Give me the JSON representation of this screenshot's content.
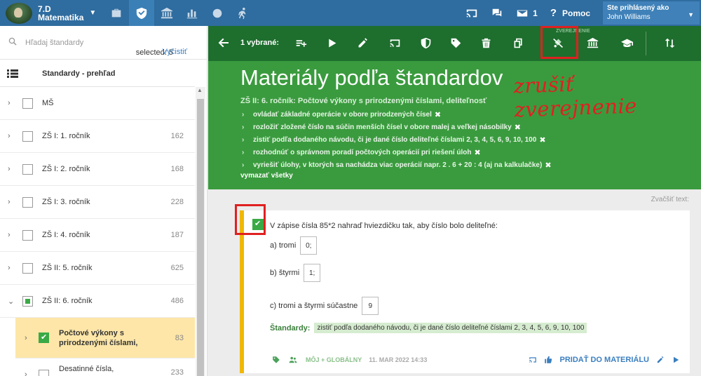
{
  "topbar": {
    "class_name": "7.D",
    "subject": "Matematika",
    "help_label": "Pomoc",
    "mail_count": "1",
    "user_label": "Ste prihlásený ako",
    "user_name": "John Williams"
  },
  "left": {
    "search_placeholder": "Hľadaj štandardy",
    "selected_text": "selected: 5",
    "clear_label": "Vyčistiť",
    "tree_title": "Standardy - prehľad",
    "items": [
      {
        "label": "MŠ",
        "count": ""
      },
      {
        "label": "ZŠ I: 1. ročník",
        "count": "162"
      },
      {
        "label": "ZŠ I: 2. ročník",
        "count": "168"
      },
      {
        "label": "ZŠ I: 3. ročník",
        "count": "228"
      },
      {
        "label": "ZŠ I: 4. ročník",
        "count": "187"
      },
      {
        "label": "ZŠ II: 5. ročník",
        "count": "625"
      },
      {
        "label": "ZŠ II: 6. ročník",
        "count": "486"
      }
    ],
    "sub_selected": {
      "label_line1": "Počtové výkony s",
      "label_line2": "prirodzenými číslami,",
      "count": "83"
    },
    "sub_last": {
      "label_line1": "Desatinné čísla,",
      "count": "233"
    }
  },
  "toolbar": {
    "selected": "1 vybrané:",
    "tooltip": "ZVEREJNENIE"
  },
  "header": {
    "title": "Materiály podľa štandardov",
    "annotation": "zrušiť zverejnenie",
    "standard_title": "ZŠ II: 6. ročník: Počtové výkony s prirodzenými číslami, deliteľnosť",
    "standards": [
      "ovládať základné operácie v obore prirodzených čísel",
      "rozložiť zložené číslo na súčin menších čísel v obore malej a veľkej násobilky",
      "zistiť podľa dodaného návodu, či je dané číslo deliteľné číslami 2, 3, 4, 5, 6, 9, 10, 100",
      "rozhodnúť o správnom poradí počtových operácií pri riešení úloh",
      "vyriešiť úlohy, v ktorých sa nachádza viac operácií napr. 2 . 6 + 20 : 4 (aj na kalkulačke)"
    ],
    "clear_all": "vymazať všetky"
  },
  "content": {
    "zoom_label": "Zvačšiť text:",
    "question": "V zápise čísla 85*2 nahraď hviezdičku tak, aby číslo bolo deliteľné:",
    "answers": [
      {
        "label": "a) tromi",
        "value": "0;"
      },
      {
        "label": "b) štyrmi",
        "value": "1;"
      },
      {
        "label": "c) tromi a štyrmi súčastne",
        "value": "9"
      }
    ],
    "standards_label": "Štandardy:",
    "standard_tag": "zistiť podľa dodaného návodu, či je dané číslo deliteľné číslami 2, 3, 4, 5, 6, 9, 10, 100",
    "scope": "MÔJ + GLOBÁLNY",
    "date": "11. MAR 2022 14:33",
    "add_label": "PRIDAŤ DO MATERIÁLU"
  }
}
